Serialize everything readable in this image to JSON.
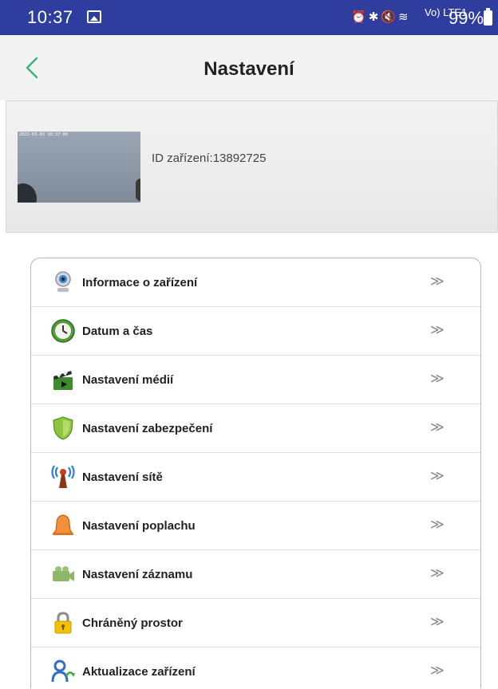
{
  "status_bar": {
    "time": "10:37",
    "network_label": "Vo) LTE1",
    "battery_text": "99%",
    "icons": [
      "gallery-icon",
      "alarm-icon",
      "bluetooth-icon",
      "mute-icon",
      "wifi-icon",
      "signal-icon",
      "battery-icon"
    ]
  },
  "app_bar": {
    "title": "Nastavení",
    "accent_color": "#3bb37a"
  },
  "device": {
    "osd_text": "2022-03-03 10:37:00",
    "id_text": "ID zařízení:13892725"
  },
  "menu": {
    "chevron": "≫",
    "items": [
      {
        "label": "Informace o zařízení",
        "icon": "webcam-icon"
      },
      {
        "label": "Datum a čas",
        "icon": "clock-icon"
      },
      {
        "label": "Nastavení médií",
        "icon": "clapperboard-icon"
      },
      {
        "label": "Nastavení zabezpečení",
        "icon": "shield-icon"
      },
      {
        "label": "Nastavení sítě",
        "icon": "antenna-icon"
      },
      {
        "label": "Nastavení poplachu",
        "icon": "bell-icon"
      },
      {
        "label": "Nastavení záznamu",
        "icon": "camcorder-icon"
      },
      {
        "label": "Chráněný prostor",
        "icon": "lock-icon"
      },
      {
        "label": "Aktualizace zařízení",
        "icon": "update-user-icon"
      }
    ]
  },
  "colors": {
    "status_bar": "#2f3e9e",
    "app_bar": "#f3f3f3",
    "back_arrow": "#3bb37a"
  }
}
